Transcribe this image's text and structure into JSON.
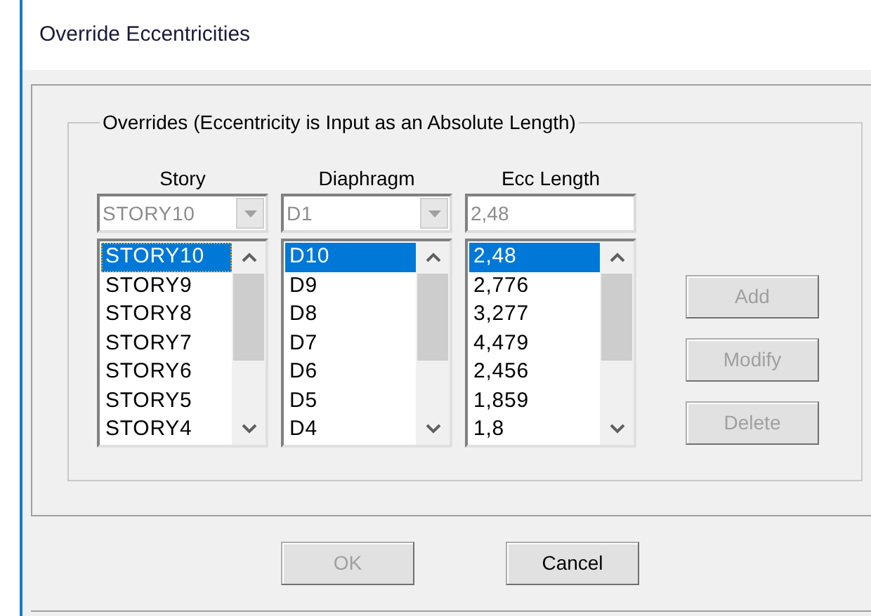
{
  "window": {
    "title": "Override Eccentricities"
  },
  "group": {
    "title": "Overrides  (Eccentricity is Input as an Absolute Length)"
  },
  "columns": [
    {
      "heading": "Story",
      "kind": "combo",
      "value": "STORY10",
      "disabled": true,
      "items": [
        {
          "label": "STORY10",
          "selected": true
        },
        {
          "label": "STORY9",
          "selected": false
        },
        {
          "label": "STORY8",
          "selected": false
        },
        {
          "label": "STORY7",
          "selected": false
        },
        {
          "label": "STORY6",
          "selected": false
        },
        {
          "label": "STORY5",
          "selected": false
        },
        {
          "label": "STORY4",
          "selected": false
        }
      ]
    },
    {
      "heading": "Diaphragm",
      "kind": "combo",
      "value": "D1",
      "disabled": true,
      "items": [
        {
          "label": "D10",
          "selected": true
        },
        {
          "label": "D9",
          "selected": false
        },
        {
          "label": "D8",
          "selected": false
        },
        {
          "label": "D7",
          "selected": false
        },
        {
          "label": "D6",
          "selected": false
        },
        {
          "label": "D5",
          "selected": false
        },
        {
          "label": "D4",
          "selected": false
        }
      ]
    },
    {
      "heading": "Ecc Length",
      "kind": "text",
      "value": "2,48",
      "disabled": true,
      "items": [
        {
          "label": "2,48",
          "selected": true
        },
        {
          "label": "2,776",
          "selected": false
        },
        {
          "label": "3,277",
          "selected": false
        },
        {
          "label": "4,479",
          "selected": false
        },
        {
          "label": "2,456",
          "selected": false
        },
        {
          "label": "1,859",
          "selected": false
        },
        {
          "label": "1,8",
          "selected": false
        }
      ]
    }
  ],
  "side_buttons": [
    {
      "label": "Add",
      "disabled": true
    },
    {
      "label": "Modify",
      "disabled": true
    },
    {
      "label": "Delete",
      "disabled": true
    }
  ],
  "buttons": [
    {
      "label": "OK",
      "disabled": true
    },
    {
      "label": "Cancel",
      "disabled": false
    }
  ]
}
